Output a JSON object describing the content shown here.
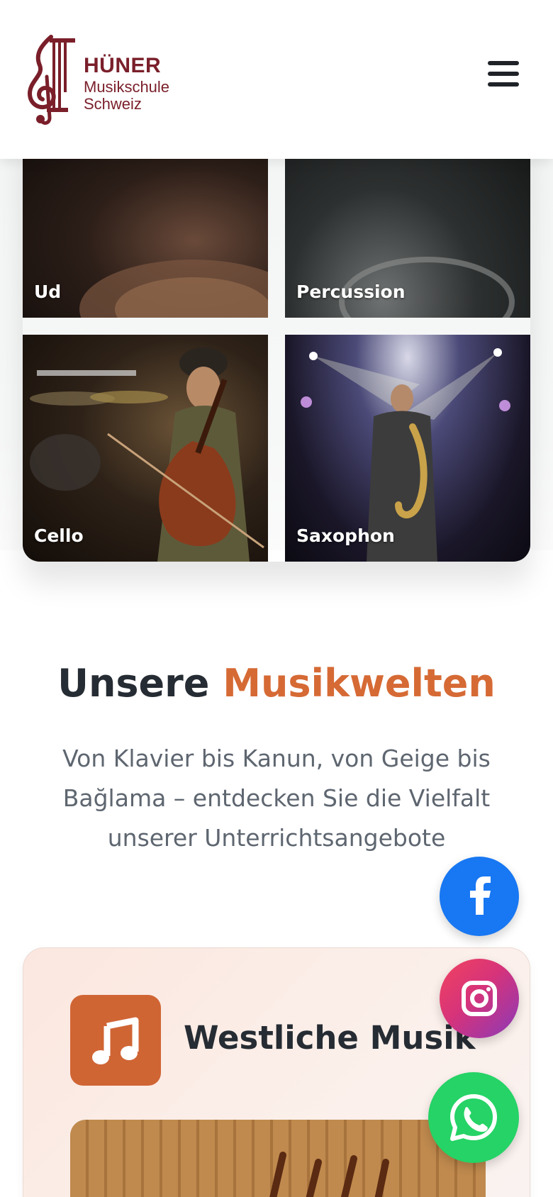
{
  "header": {
    "logo": {
      "line1": "HÜNER",
      "line2": "Musikschule",
      "line3": "Schweiz",
      "icon": "treble-clef-column-icon",
      "color": "#7a1f2a"
    },
    "menu_icon": "hamburger-menu-icon"
  },
  "gallery": {
    "items": [
      {
        "label": "Ud"
      },
      {
        "label": "Percussion"
      },
      {
        "label": "Cello"
      },
      {
        "label": "Saxophon"
      }
    ]
  },
  "section": {
    "title_part1": "Unsere",
    "title_accent": "Musikwelten",
    "subtitle": "Von Klavier bis Kanun, von Geige bis Bağlama – entdecken Sie die Vielfalt unserer Unterrichtsangebote",
    "accent_color": "#d66a35"
  },
  "card": {
    "icon": "music-note-icon",
    "title": "Westliche Musik",
    "icon_bg": "#d06534"
  },
  "social": {
    "facebook": {
      "icon": "facebook-icon",
      "color": "#1877f2"
    },
    "instagram": {
      "icon": "instagram-icon",
      "color": "#d6337a"
    },
    "whatsapp": {
      "icon": "whatsapp-icon",
      "color": "#25d366"
    }
  }
}
